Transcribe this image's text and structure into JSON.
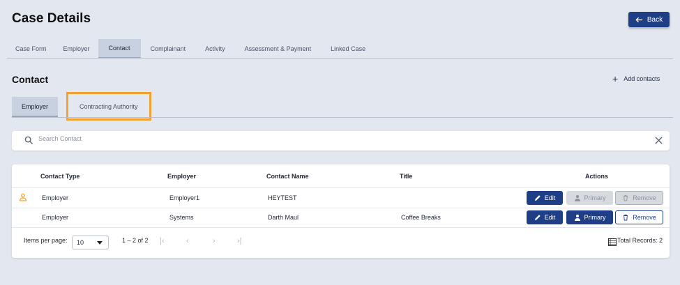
{
  "header": {
    "title": "Case Details",
    "back_label": "Back"
  },
  "tabs": [
    {
      "label": "Case Form"
    },
    {
      "label": "Employer"
    },
    {
      "label": "Contact"
    },
    {
      "label": "Complainant"
    },
    {
      "label": "Activity"
    },
    {
      "label": "Assessment & Payment"
    },
    {
      "label": "Linked Case"
    }
  ],
  "contact": {
    "title": "Contact",
    "add_label": "Add contacts",
    "subtabs": [
      {
        "label": "Employer"
      },
      {
        "label": "Contracting Authority"
      }
    ]
  },
  "search": {
    "placeholder": "Search Contact"
  },
  "table": {
    "headers": {
      "contact_type": "Contact Type",
      "employer": "Employer",
      "contact_name": "Contact Name",
      "title": "Title",
      "actions": "Actions"
    },
    "rows": [
      {
        "contact_type": "Employer",
        "employer": "Employer1",
        "contact_name": "HEYTEST",
        "title": "",
        "primary": true
      },
      {
        "contact_type": "Employer",
        "employer": "Systems",
        "contact_name": "Darth Maul",
        "title": "Coffee Breaks",
        "primary": false
      }
    ],
    "actions": {
      "edit": "Edit",
      "primary": "Primary",
      "remove": "Remove"
    }
  },
  "footer": {
    "per_page_label": "Items per page:",
    "per_page_value": "10",
    "range": "1 – 2 of 2",
    "total_records": "Total Records: 2"
  },
  "colors": {
    "accent": "#1e3f87",
    "highlight": "#f5a12f",
    "background": "#e3e8f0",
    "primary_icon": "#f0a030"
  }
}
